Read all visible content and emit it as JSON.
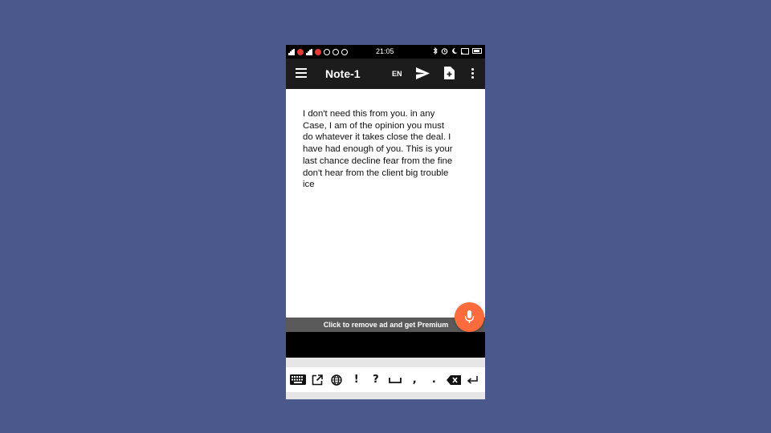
{
  "status_bar": {
    "time": "21:05",
    "left_icons": [
      "signal-icon",
      "vodafone-icon",
      "signal-icon",
      "flash-icon",
      "sync-icon",
      "wifi-icon",
      "call-icon"
    ],
    "right_icons": [
      "bluetooth-icon",
      "alarm-icon",
      "moon-icon",
      "cast-icon",
      "battery-icon"
    ]
  },
  "toolbar": {
    "title": "Note-1",
    "language": "EN",
    "icons": [
      "menu-icon",
      "send-icon",
      "new-note-icon",
      "more-icon"
    ]
  },
  "note": {
    "text": "I don't need this from you. in any\nCase, I am of the opinion you must\ndo whatever it takes close the deal. I\nhave had enough of you. This is your\nlast chance decline fear from the fine\ndon't hear from the client big trouble\nice"
  },
  "ad_bar": {
    "label": "Click to remove ad and get Premium"
  },
  "fab": {
    "icon": "microphone-icon",
    "color": "#ff6b3d"
  },
  "keyboard": {
    "keys": [
      {
        "name": "keyboard-toggle-icon",
        "glyph": ""
      },
      {
        "name": "open-external-icon",
        "glyph": ""
      },
      {
        "name": "globe-icon",
        "glyph": ""
      },
      {
        "name": "key-exclamation",
        "glyph": "!"
      },
      {
        "name": "key-question",
        "glyph": "?"
      },
      {
        "name": "space-icon",
        "glyph": ""
      },
      {
        "name": "key-comma",
        "glyph": ","
      },
      {
        "name": "key-period",
        "glyph": "."
      },
      {
        "name": "backspace-icon",
        "glyph": ""
      },
      {
        "name": "enter-icon",
        "glyph": ""
      }
    ]
  },
  "colors": {
    "background": "#4b588c",
    "toolbar": "#1c1c1c",
    "accent": "#ff6b3d",
    "ad_bar": "#5a5a5a"
  }
}
